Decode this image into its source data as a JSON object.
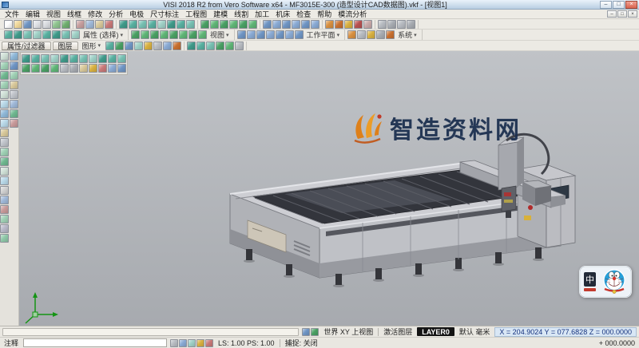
{
  "window": {
    "title": "VISI 2018 R2 from Vero Software x64  -  MF3015E-300 (造型设计CAD数据图).vkf - [视图1]",
    "min": "–",
    "max": "□",
    "close": "×"
  },
  "menu": {
    "items": [
      "文件",
      "编辑",
      "视图",
      "线框",
      "修改",
      "分析",
      "电极",
      "尺寸标注",
      "工程图",
      "建模",
      "线割",
      "加工",
      "机床",
      "检查",
      "帮助",
      "模流分析"
    ]
  },
  "toolbar1": {
    "groups": [
      {
        "icons": [
          {
            "n": "new-file-icon",
            "c": "#fdfdfd"
          },
          {
            "n": "open-file-icon",
            "c": "#f0d89a"
          },
          {
            "n": "save-icon",
            "c": "#6f95c4"
          },
          {
            "n": "import-icon",
            "c": "#e0e2e6"
          },
          {
            "n": "print-icon",
            "c": "#d9dce0"
          },
          {
            "n": "undo-icon",
            "c": "#8fc48f"
          },
          {
            "n": "redo-icon",
            "c": "#6fae6f"
          }
        ]
      },
      {
        "icons": [
          {
            "n": "cut-icon",
            "c": "#c89f9f"
          },
          {
            "n": "copy-icon",
            "c": "#9fb8d8"
          },
          {
            "n": "paste-icon",
            "c": "#d8c89a"
          },
          {
            "n": "delete-icon",
            "c": "#c87878"
          }
        ]
      },
      {
        "icons": [
          {
            "n": "zoom-extents-icon",
            "c": "#3f9a8a"
          },
          {
            "n": "zoom-window-icon",
            "c": "#58b0a0"
          },
          {
            "n": "zoom-in-icon",
            "c": "#77c0b2"
          },
          {
            "n": "zoom-out-icon",
            "c": "#58b0a0"
          },
          {
            "n": "pan-icon",
            "c": "#9fd0c6"
          },
          {
            "n": "rotate-view-icon",
            "c": "#3f9a8a"
          },
          {
            "n": "shade-mode-icon",
            "c": "#58b0a0"
          },
          {
            "n": "wireframe-mode-icon",
            "c": "#77c0b2"
          }
        ]
      },
      {
        "icons": [
          {
            "n": "line-icon",
            "c": "#4aa064"
          },
          {
            "n": "arc-icon",
            "c": "#5fb576"
          },
          {
            "n": "circle-icon",
            "c": "#4aa064"
          },
          {
            "n": "rectangle-icon",
            "c": "#5fb576"
          },
          {
            "n": "polyline-icon",
            "c": "#4aa064"
          },
          {
            "n": "spline-icon",
            "c": "#5fb576"
          }
        ]
      },
      {
        "icons": [
          {
            "n": "extrude-icon",
            "c": "#6f95c4"
          },
          {
            "n": "revolve-icon",
            "c": "#8aaad4"
          },
          {
            "n": "boolean-icon",
            "c": "#6f95c4"
          },
          {
            "n": "fillet-icon",
            "c": "#8aaad4"
          },
          {
            "n": "shell-icon",
            "c": "#6f95c4"
          },
          {
            "n": "chamfer-icon",
            "c": "#8aaad4"
          }
        ]
      },
      {
        "icons": [
          {
            "n": "measure-icon",
            "c": "#d89040"
          },
          {
            "n": "section-icon",
            "c": "#c87030"
          },
          {
            "n": "draft-check-icon",
            "c": "#d8b040"
          },
          {
            "n": "curvature-icon",
            "c": "#b85050"
          },
          {
            "n": "report-icon",
            "c": "#c8a8a8"
          }
        ]
      },
      {
        "icons": [
          {
            "n": "layers-icon",
            "c": "#b8bcc2"
          },
          {
            "n": "filters-icon",
            "c": "#a8acb2"
          },
          {
            "n": "settings-icon",
            "c": "#b8bcc2"
          },
          {
            "n": "help-icon",
            "c": "#a8acb2"
          }
        ]
      }
    ]
  },
  "toolbar2": {
    "groups": [
      {
        "label": "属性 (选择)",
        "icons": [
          {
            "n": "select-icon",
            "c": "#58b0a0"
          },
          {
            "n": "select-chain-icon",
            "c": "#3f9a8a"
          },
          {
            "n": "select-box-icon",
            "c": "#77c0b2"
          },
          {
            "n": "select-color-icon",
            "c": "#9fd0c6"
          },
          {
            "n": "select-layer-icon",
            "c": "#58b0a0"
          },
          {
            "n": "select-type-icon",
            "c": "#3f9a8a"
          },
          {
            "n": "invert-selection-icon",
            "c": "#77c0b2"
          },
          {
            "n": "clear-selection-icon",
            "c": "#9fd0c6"
          }
        ]
      },
      {
        "label": "视图",
        "icons": [
          {
            "n": "view-iso-icon",
            "c": "#4aa064"
          },
          {
            "n": "view-top-icon",
            "c": "#5fb576"
          },
          {
            "n": "view-front-icon",
            "c": "#4aa064"
          },
          {
            "n": "view-right-icon",
            "c": "#5fb576"
          },
          {
            "n": "view-back-icon",
            "c": "#4aa064"
          },
          {
            "n": "view-left-icon",
            "c": "#5fb576"
          },
          {
            "n": "view-bottom-icon",
            "c": "#4aa064"
          },
          {
            "n": "view-custom-icon",
            "c": "#5fb576"
          }
        ]
      },
      {
        "label": "工作平面",
        "icons": [
          {
            "n": "workplane-xy-icon",
            "c": "#6f95c4"
          },
          {
            "n": "workplane-xz-icon",
            "c": "#8aaad4"
          },
          {
            "n": "workplane-yz-icon",
            "c": "#6f95c4"
          },
          {
            "n": "workplane-3pt-icon",
            "c": "#8aaad4"
          },
          {
            "n": "workplane-face-icon",
            "c": "#6f95c4"
          },
          {
            "n": "workplane-rotate-icon",
            "c": "#8aaad4"
          },
          {
            "n": "workplane-reset-icon",
            "c": "#6f95c4"
          }
        ]
      },
      {
        "label": "系统",
        "icons": [
          {
            "n": "system-settings-icon",
            "c": "#d89040"
          },
          {
            "n": "grid-icon",
            "c": "#b8bcc2"
          },
          {
            "n": "snap-icon",
            "c": "#d8b040"
          },
          {
            "n": "units-icon",
            "c": "#a8acb2"
          },
          {
            "n": "macro-icon",
            "c": "#c87030"
          }
        ]
      }
    ]
  },
  "toolbar3": {
    "tabs": [
      "属性/过滤器",
      "图层"
    ],
    "label": "图形",
    "groups": [
      {
        "icons": [
          {
            "n": "render-shaded-icon",
            "c": "#58b0a0"
          },
          {
            "n": "render-wire-icon",
            "c": "#4aa064"
          },
          {
            "n": "render-hidden-icon",
            "c": "#6f95c4"
          },
          {
            "n": "render-transparent-icon",
            "c": "#9fd0c6"
          },
          {
            "n": "light-icon",
            "c": "#d8b040"
          },
          {
            "n": "background-icon",
            "c": "#b8bcc2"
          },
          {
            "n": "perspective-icon",
            "c": "#8aaad4"
          },
          {
            "n": "clip-plane-icon",
            "c": "#c87030"
          }
        ]
      },
      {
        "icons": [
          {
            "n": "dynamic-rotate-icon",
            "c": "#3f9a8a"
          },
          {
            "n": "dynamic-pan-icon",
            "c": "#58b0a0"
          },
          {
            "n": "dynamic-zoom-icon",
            "c": "#77c0b2"
          },
          {
            "n": "previous-view-icon",
            "c": "#4aa064"
          },
          {
            "n": "next-view-icon",
            "c": "#5fb576"
          },
          {
            "n": "full-screen-icon",
            "c": "#b8bcc2"
          }
        ]
      }
    ]
  },
  "left_toolbar": {
    "col1": [
      {
        "n": "point-icon",
        "c": "#cfe0d6"
      },
      {
        "n": "line-tool-icon",
        "c": "#9fd0b4"
      },
      {
        "n": "arc-tool-icon",
        "c": "#6fb890"
      },
      {
        "n": "circle-tool-icon",
        "c": "#9fd0b4"
      },
      {
        "n": "ellipse-icon",
        "c": "#cfe0d6"
      },
      {
        "n": "rectangle-tool-icon",
        "c": "#b8d8e8"
      },
      {
        "n": "polygon-icon",
        "c": "#8fb8d8"
      },
      {
        "n": "spline-tool-icon",
        "c": "#b8d8e8"
      },
      {
        "n": "offset-icon",
        "c": "#d8c89a"
      },
      {
        "n": "trim-icon",
        "c": "#c0c4ca"
      },
      {
        "n": "extend-icon",
        "c": "#9fd0b4"
      },
      {
        "n": "fillet-tool-icon",
        "c": "#6fb890"
      },
      {
        "n": "chamfer-tool-icon",
        "c": "#cfe0d6"
      },
      {
        "n": "mirror-icon",
        "c": "#b8d8e8"
      },
      {
        "n": "move-icon",
        "c": "#d0d0d0"
      },
      {
        "n": "rotate-tool-icon",
        "c": "#9fb8d8"
      },
      {
        "n": "scale-icon",
        "c": "#c89a9a"
      },
      {
        "n": "array-icon",
        "c": "#9fd0b4"
      },
      {
        "n": "text-tool-icon",
        "c": "#b8b8c8"
      },
      {
        "n": "dimension-tool-icon",
        "c": "#8fc8a8"
      }
    ],
    "col2": [
      {
        "n": "surface-icon",
        "c": "#8fb8d8"
      },
      {
        "n": "solid-icon",
        "c": "#6f95c4"
      },
      {
        "n": "feature-icon",
        "c": "#9fd0b4"
      },
      {
        "n": "assembly-icon",
        "c": "#d8c89a"
      },
      {
        "n": "sheetmetal-icon",
        "c": "#c0c4ca"
      },
      {
        "n": "mesh-icon",
        "c": "#9fb8d8"
      },
      {
        "n": "curve-icon",
        "c": "#6fb890"
      },
      {
        "n": "analysis-tool-icon",
        "c": "#c89a9a"
      }
    ]
  },
  "viewport": {
    "floating_icons_row1": [
      {
        "n": "shade-icon",
        "c": "#3f9a8a"
      },
      {
        "n": "wireframe-icon",
        "c": "#58b0a0"
      },
      {
        "n": "hidden-line-icon",
        "c": "#77c0b2"
      },
      {
        "n": "transparent-icon",
        "c": "#9fd0c6"
      },
      {
        "n": "iso-view-icon",
        "c": "#3f9a8a"
      },
      {
        "n": "top-view-icon",
        "c": "#58b0a0"
      },
      {
        "n": "front-view-icon",
        "c": "#77c0b2"
      },
      {
        "n": "side-view-icon",
        "c": "#9fd0c6"
      },
      {
        "n": "zoom-all-icon",
        "c": "#3f9a8a"
      },
      {
        "n": "zoom-selection-icon",
        "c": "#58b0a0"
      },
      {
        "n": "repaint-icon",
        "c": "#77c0b2"
      }
    ],
    "floating_icons_row2": [
      {
        "n": "layer-on-icon",
        "c": "#4aa064"
      },
      {
        "n": "layer-off-icon",
        "c": "#5fb576"
      },
      {
        "n": "group-icon",
        "c": "#4aa064"
      },
      {
        "n": "ungroup-icon",
        "c": "#5fb576"
      },
      {
        "n": "hide-icon",
        "c": "#b8bcc2"
      },
      {
        "n": "show-all-icon",
        "c": "#a8acb2"
      },
      {
        "n": "lock-icon",
        "c": "#d8c89a"
      },
      {
        "n": "unlock-icon",
        "c": "#d8b040"
      },
      {
        "n": "color-icon",
        "c": "#c87878"
      },
      {
        "n": "linetype-icon",
        "c": "#8aaad4"
      },
      {
        "n": "lineweight-icon",
        "c": "#6f95c4"
      }
    ],
    "watermark": {
      "text": "智造资料网"
    },
    "sticker": {
      "label": "中"
    }
  },
  "statusbar": {
    "row1_icons": [
      {
        "n": "status-view-icon",
        "c": "#6f95c4"
      },
      {
        "n": "status-layer-icon",
        "c": "#4aa064"
      }
    ],
    "row2_icons": [
      {
        "n": "note-icon",
        "c": "#b8bcc2"
      },
      {
        "n": "calculator-icon",
        "c": "#8aaad4"
      },
      {
        "n": "grid-toggle-icon",
        "c": "#9fd0c6"
      },
      {
        "n": "ortho-icon",
        "c": "#d8b040"
      },
      {
        "n": "tracking-icon",
        "c": "#c87878"
      }
    ],
    "row1": {
      "view": "世界 XY 上视图",
      "active_layer_label": "激活图层",
      "layer": "LAYER0",
      "units": "默认 毫米",
      "coords": "X = 204.9024 Y = 077.6828 Z = 000.0000"
    },
    "row2": {
      "note_label": "注释",
      "note_value": "",
      "scale": "LS: 1.00 PS: 1.00",
      "snap": "捕捉: 关闭",
      "z": "+ 000.0000"
    }
  }
}
